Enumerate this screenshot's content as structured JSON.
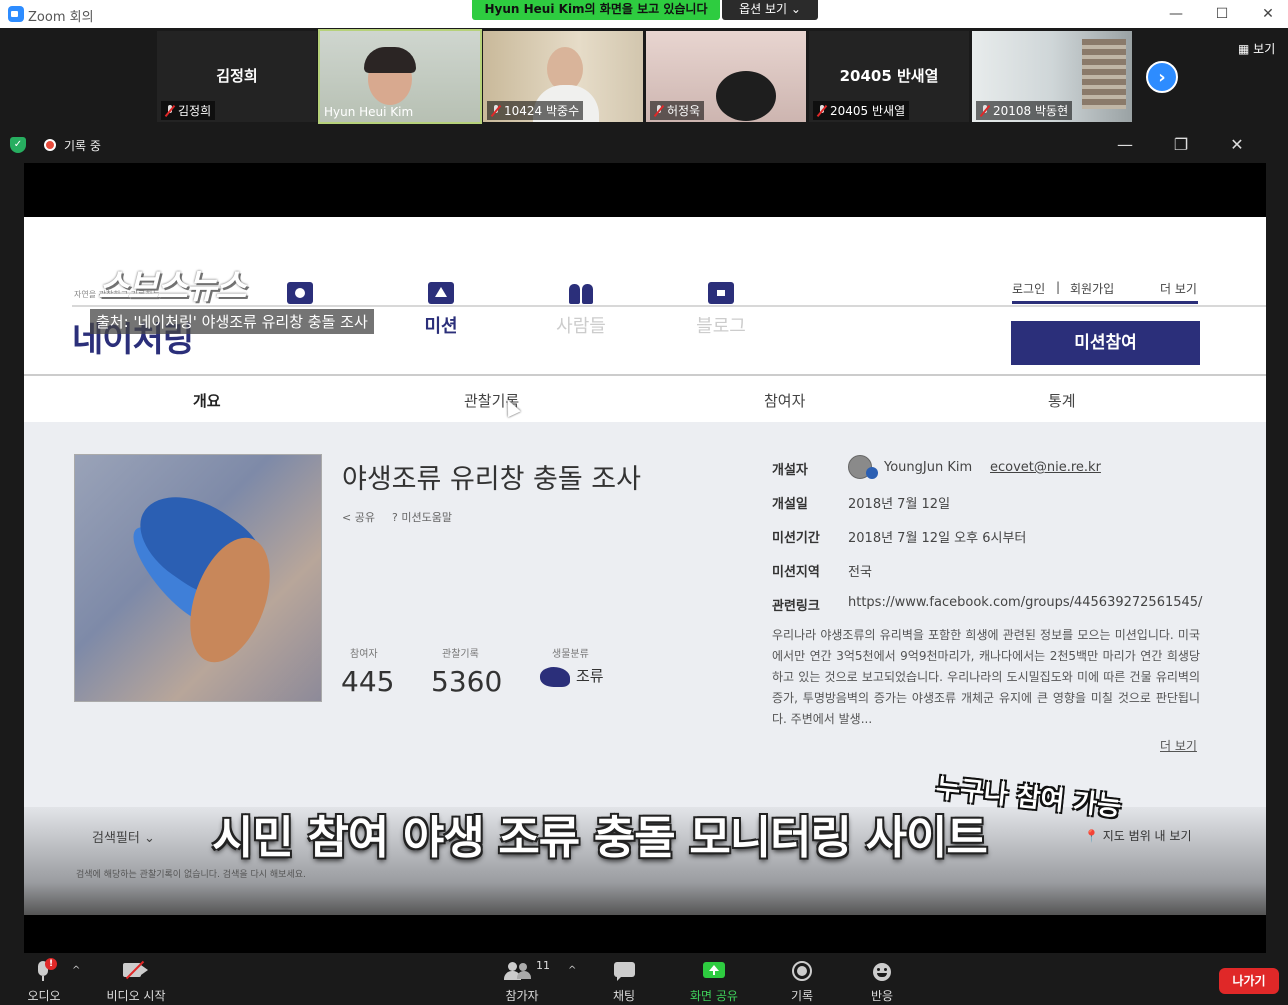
{
  "window": {
    "title": "Zoom 회의",
    "share_banner": "Hyun Heui Kim의 화면을 보고 있습니다",
    "view_options": "옵션 보기 ⌄",
    "minimize": "—",
    "maximize": "☐",
    "close": "✕"
  },
  "gallery": {
    "view_label": "▦ 보기",
    "next": "›",
    "tiles": [
      {
        "bigname": "김정희",
        "name": "김정희"
      },
      {
        "bigname": "",
        "name": "Hyun Heui Kim"
      },
      {
        "bigname": "",
        "name": "10424 박중수"
      },
      {
        "bigname": "",
        "name": "허정욱"
      },
      {
        "bigname": "20405 반새열",
        "name": "20405 반새열"
      },
      {
        "bigname": "",
        "name": "20108 박동현"
      }
    ]
  },
  "share": {
    "recording": "기록 중",
    "shield": "✓",
    "minimize": "—",
    "restore": "❐",
    "close": "✕"
  },
  "site": {
    "logo_sbs": "스브스뉴스",
    "logo_main": "네이처링",
    "logo_sub": "자연을 관찰하고 기록하는",
    "caption_top": "출처: '네이처링' 야생조류 유리창 충돌 조사",
    "nav": [
      {
        "label": "",
        "icon": "camera-icon"
      },
      {
        "label": "미션",
        "icon": "flag-icon"
      },
      {
        "label": "사람들",
        "icon": "people-icon"
      },
      {
        "label": "블로그",
        "icon": "blog-icon"
      }
    ],
    "login": "로그인",
    "separator": "|",
    "signup": "회원가입",
    "more": "더 보기",
    "mission_button": "미션참여",
    "tabs": [
      "개요",
      "관찰기록",
      "참여자",
      "통계"
    ],
    "mission_title": "야생조류 유리창 충돌 조사",
    "share_link": "< 공유",
    "help_link": "? 미션도움말",
    "stats": [
      {
        "label": "참여자",
        "value": "445"
      },
      {
        "label": "관찰기록",
        "value": "5360"
      }
    ],
    "bio_label": "생물분류",
    "bio_value": "조류",
    "info": {
      "creator_label": "개설자",
      "creator_name": "YoungJun Kim",
      "creator_email": "ecovet@nie.re.kr",
      "opened_label": "개설일",
      "opened_value": "2018년 7월 12일",
      "period_label": "미션기간",
      "period_value": "2018년 7월 12일 오후 6시부터",
      "region_label": "미션지역",
      "region_value": "전국",
      "link_label": "관련링크",
      "link_value": "https://www.facebook.com/groups/445639272561545/"
    },
    "description": "우리나라 야생조류의 유리벽을 포함한 희생에 관련된 정보를 모으는 미션입니다. 미국에서만 연간 3억5천에서 9억9천마리가, 캐나다에서는 2천5백만 마리가 연간 희생당하고 있는 것으로 보고되었습니다. 우리나라의 도시밀집도와 미에 따른 건물 유리벽의 증가, 투명방음벽의 증가는 야생조류 개체군 유지에 큰 영향을 미칠 것으로 판단됩니다. 주변에서 발생...",
    "more_link": "더 보기",
    "filter_label": "검색필터 ⌄",
    "map_link": "📍 지도 범위 내 보기",
    "filter_note": "검색에 해당하는 관찰기록이 없습니다. 검색을 다시 해보세요.",
    "hand_caption": "누구나 참여 가능",
    "main_caption": "시민 참여 야생 조류 충돌 모니터링 사이트"
  },
  "toolbar": {
    "audio": "오디오",
    "audio_badge": "!",
    "video": "비디오 시작",
    "participants": "참가자",
    "participants_count": "11",
    "chat": "채팅",
    "share_screen": "화면 공유",
    "record": "기록",
    "reactions": "반응",
    "leave": "나가기",
    "caret": "^"
  },
  "colors": {
    "zoom_blue": "#2D8CFF",
    "banner_green": "#2ECC40",
    "leave_red": "#E02828",
    "site_navy": "#2B2F7A"
  }
}
